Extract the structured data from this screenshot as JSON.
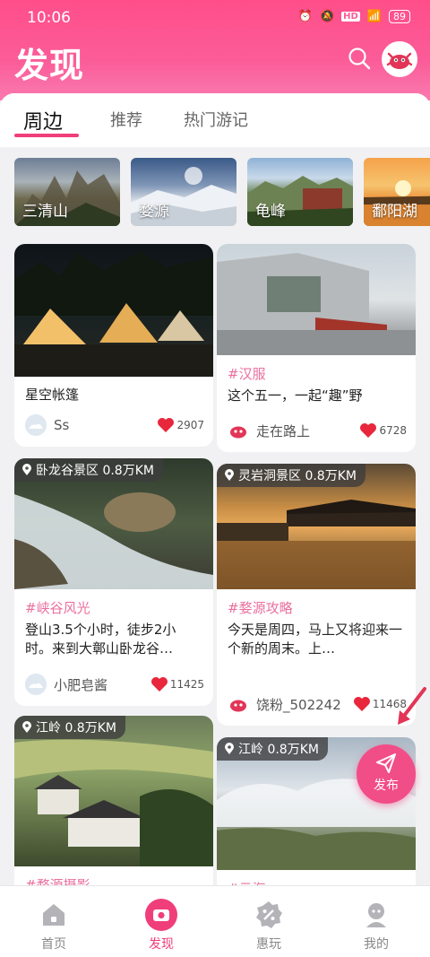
{
  "status_bar": {
    "time": "10:06",
    "battery": "89"
  },
  "header": {
    "title": "发现"
  },
  "tabs": [
    {
      "label": "周边",
      "active": true
    },
    {
      "label": "推荐",
      "active": false
    },
    {
      "label": "热门游记",
      "active": false
    }
  ],
  "scenic_spots": [
    {
      "label": "三清山"
    },
    {
      "label": "婺源"
    },
    {
      "label": "龟峰"
    },
    {
      "label": "鄱阳湖"
    }
  ],
  "feed": [
    {
      "location": "",
      "tag": "",
      "text": "星空帐篷",
      "user": "Ss",
      "likes": "2907"
    },
    {
      "location": "",
      "tag": "#汉服",
      "text": "这个五一，一起“趣”野",
      "user": "走在路上",
      "likes": "6728"
    },
    {
      "location": "卧龙谷景区 0.8万KM",
      "tag": "#峡谷风光",
      "text": "登山3.5个小时，徒步2小时。来到大鄣山卧龙谷…",
      "user": "小肥皂酱",
      "likes": "11425"
    },
    {
      "location": "灵岩洞景区 0.8万KM",
      "tag": "#婺源攻略",
      "text": "今天是周四，马上又将迎来一个新的周末。上…",
      "user": "饶粉_502242",
      "likes": "11468"
    },
    {
      "location": "江岭 0.8万KM",
      "tag": "#婺源摄影",
      "text": "",
      "user": "",
      "likes": ""
    },
    {
      "location": "江岭 0.8万KM",
      "tag": "#云海",
      "text": "",
      "user": "",
      "likes": ""
    }
  ],
  "fab": {
    "label": "发布"
  },
  "bottom_nav": [
    {
      "label": "首页",
      "icon": "home-icon"
    },
    {
      "label": "发现",
      "icon": "camera-icon",
      "active": true
    },
    {
      "label": "惠玩",
      "icon": "discount-icon"
    },
    {
      "label": "我的",
      "icon": "profile-icon"
    }
  ],
  "colors": {
    "brand": "#f03e7a",
    "header_gradient_start": "#ff4e8a",
    "tag": "#ea6f9e",
    "heart": "#e8273c"
  }
}
